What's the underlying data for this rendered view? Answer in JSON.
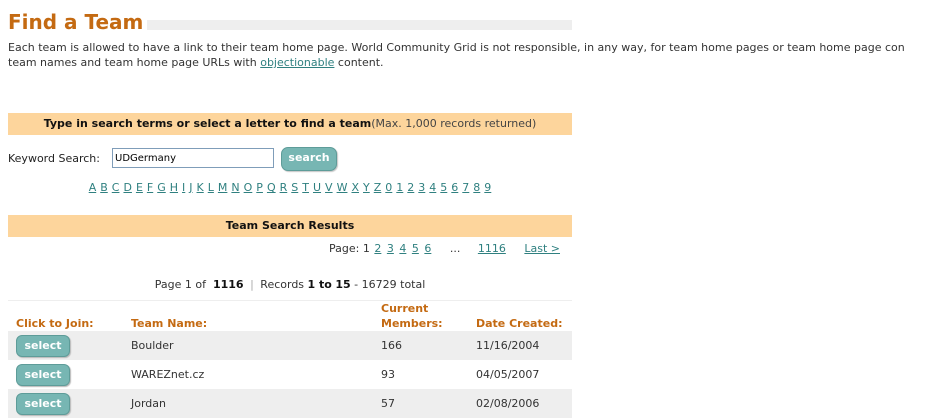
{
  "page": {
    "title": "Find a Team",
    "intro_line1": "Each team is allowed to have a link to their team home page. World Community Grid is not responsible, in any way, for team home pages or team home page con",
    "intro_line2_before": "team names and team home page URLs with ",
    "intro_link": "objectionable",
    "intro_line2_after": " content."
  },
  "search": {
    "header_strong": "Type in search terms or select a letter to find a team",
    "header_note": "(Max. 1,000 records returned)",
    "keyword_label": "Keyword Search:",
    "keyword_value": "UDGermany",
    "button_label": "search",
    "letters": [
      "A",
      "B",
      "C",
      "D",
      "E",
      "F",
      "G",
      "H",
      "I",
      "J",
      "K",
      "L",
      "M",
      "N",
      "O",
      "P",
      "Q",
      "R",
      "S",
      "T",
      "U",
      "V",
      "W",
      "X",
      "Y",
      "Z",
      "0",
      "1",
      "2",
      "3",
      "4",
      "5",
      "6",
      "7",
      "8",
      "9"
    ]
  },
  "results": {
    "header": "Team Search Results",
    "pager_label": "Page:",
    "current_page": "1",
    "pages": [
      "2",
      "3",
      "4",
      "5",
      "6"
    ],
    "ellipsis": "...",
    "last_page_num": "1116",
    "last_label": "Last >",
    "summary": {
      "page_prefix": "Page 1 of",
      "total_pages": "1116",
      "records_label": "Records",
      "records_range": "1 to",
      "records_end": "15",
      "total": "- 16729 total"
    },
    "columns": {
      "join": "Click to Join:",
      "name": "Team Name:",
      "members_line1": "Current",
      "members_line2": "Members:",
      "created": "Date Created:"
    },
    "rows": [
      {
        "button": "select",
        "name": "Boulder",
        "members": "166",
        "created": "11/16/2004"
      },
      {
        "button": "select",
        "name": "WAREZnet.cz",
        "members": "93",
        "created": "04/05/2007"
      },
      {
        "button": "select",
        "name": "Jordan",
        "members": "57",
        "created": "02/08/2006"
      }
    ]
  },
  "colors": {
    "title": "#c46a12",
    "header_band": "#fdd59c",
    "link": "#2f8080",
    "button": "#77b6b3"
  }
}
